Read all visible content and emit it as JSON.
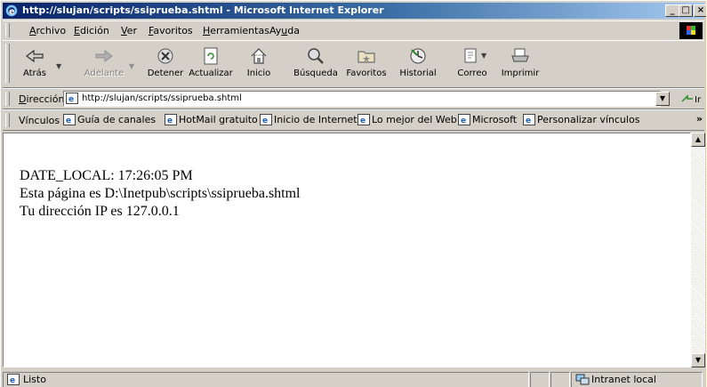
{
  "window": {
    "title": "http://slujan/scripts/ssiprueba.shtml - Microsoft Internet Explorer",
    "controls": {
      "minimize": "_",
      "maximize": "□",
      "close": "×"
    }
  },
  "menu": {
    "items": [
      {
        "accel": "A",
        "rest": "rchivo"
      },
      {
        "accel": "E",
        "rest": "dición"
      },
      {
        "accel": "V",
        "rest": "er"
      },
      {
        "accel": "F",
        "rest": "avoritos"
      },
      {
        "accel": "H",
        "rest": "erramientas"
      },
      {
        "pre": "Ay",
        "accel": "u",
        "rest": "da"
      }
    ]
  },
  "toolbar": {
    "back": "Atrás",
    "forward": "Adelante",
    "stop": "Detener",
    "refresh": "Actualizar",
    "home": "Inicio",
    "search": "Búsqueda",
    "favorites": "Favoritos",
    "history": "Historial",
    "mail": "Correo",
    "print": "Imprimir"
  },
  "address": {
    "label_accel": "D",
    "label_rest": "irección",
    "url": "http://slujan/scripts/ssiprueba.shtml"
  },
  "links": {
    "label": "Vínculos",
    "items": [
      "Guía de canales",
      "HotMail gratuito",
      "Inicio de Internet",
      "Lo mejor del Web",
      "Microsoft",
      "Personalizar vínculos"
    ],
    "more": "»"
  },
  "page": {
    "lines": [
      "DATE_LOCAL: 17:26:05 PM",
      "Esta página es D:\\Inetpub\\scripts\\ssiprueba.shtml",
      "Tu dirección IP es 127.0.0.1"
    ]
  },
  "status": {
    "text": "Listo",
    "zone": "Intranet local"
  },
  "colors": {
    "titlebar_start": "#0a246a",
    "titlebar_end": "#a6caf0",
    "chrome": "#d4d0c8"
  }
}
